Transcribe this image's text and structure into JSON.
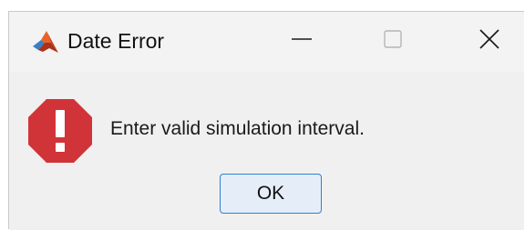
{
  "window": {
    "title": "Date Error",
    "app_icon": "matlab-logo-icon",
    "controls": {
      "minimize_icon": "minimize-icon",
      "maximize_icon": "maximize-icon",
      "close_icon": "close-icon"
    }
  },
  "dialog": {
    "icon": "error-icon",
    "icon_glyph": "!",
    "message": "Enter valid simulation interval.",
    "ok_label": "OK"
  },
  "colors": {
    "error_red": "#d13438",
    "button_border": "#2f7fd6",
    "button_bg": "#e5eef8",
    "window_bg": "#f0f0f0"
  }
}
